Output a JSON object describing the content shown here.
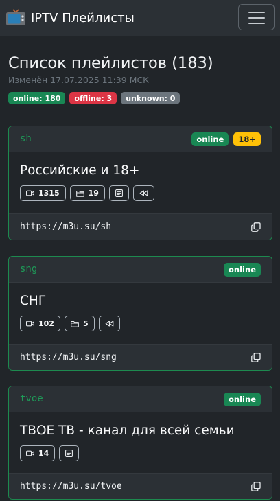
{
  "navbar": {
    "brand": "IPTV Плейлисты",
    "brand_icon": "tv-icon",
    "menu_icon": "hamburger-menu-icon"
  },
  "header": {
    "title": "Список плейлистов (183)",
    "updated": "Изменён 17.07.2025 11:39 МСК"
  },
  "summary": {
    "online": "online: 180",
    "offline": "offline: 3",
    "unknown": "unknown: 0"
  },
  "colors": {
    "online": "#198754",
    "offline": "#dc3545",
    "unknown": "#6c757d",
    "adult": "#ffc107",
    "card_border": "#1d8a4f",
    "code": "#1e9a58"
  },
  "playlists": [
    {
      "code": "sh",
      "status": "online",
      "adult": "18+",
      "name": "Российские и 18+",
      "channels": "1315",
      "groups": "19",
      "url": "https://m3u.su/sh"
    },
    {
      "code": "sng",
      "status": "online",
      "name": "СНГ",
      "channels": "102",
      "groups": "5",
      "url": "https://m3u.su/sng"
    },
    {
      "code": "tvoe",
      "status": "online",
      "name": "ТВОЕ ТВ - канал для всей семьи",
      "channels": "14",
      "url": "https://m3u.su/tvoe"
    }
  ]
}
